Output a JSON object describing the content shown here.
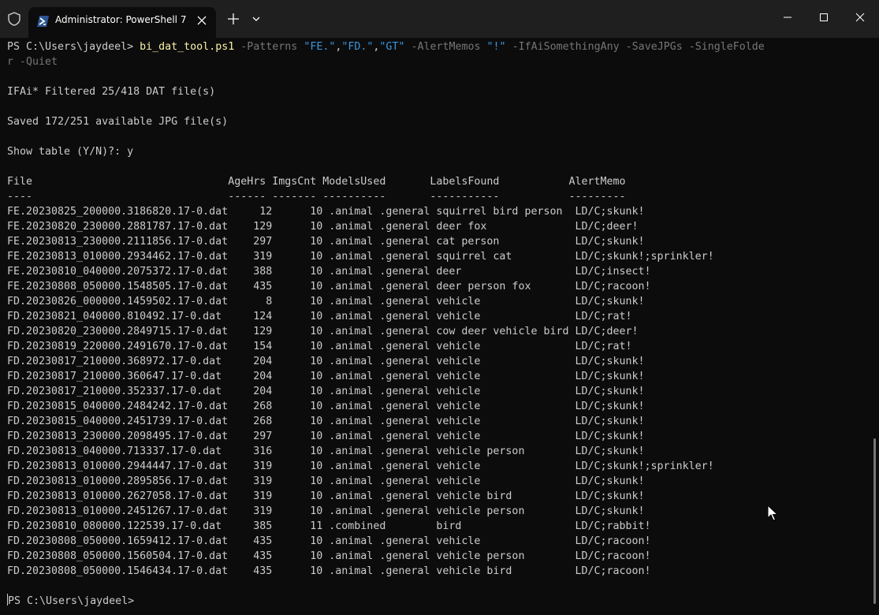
{
  "window": {
    "tab_title": "Administrator: PowerShell 7",
    "icons": [
      "shield-icon",
      "powershell-icon",
      "close-icon",
      "plus-icon",
      "chevron-down-icon",
      "minimize-icon",
      "maximize-icon",
      "close-window-icon"
    ]
  },
  "terminal": {
    "prompt": "PS C:\\Users\\jaydeel> ",
    "command": {
      "script": "bi_dat_tool.ps1",
      "p_patterns": "-Patterns",
      "v_fe": "\"FE.\"",
      "v_fd": "\"FD.\"",
      "v_gt": "\"GT\"",
      "comma": ",",
      "p_alert": "-AlertMemos",
      "v_bang": "\"!\"",
      "p_rest": "-IfAiSomethingAny -SaveJPGs -SingleFolde",
      "p_wrap": "r -Quiet"
    },
    "out_filtered": "IFAi* Filtered 25/418 DAT file(s)",
    "out_saved": "Saved 172/251 available JPG file(s)",
    "out_show": "Show table (Y/N)?: y",
    "table": {
      "header": "File                               AgeHrs ImgsCnt ModelsUsed       LabelsFound           AlertMemo",
      "separator": "----                               ------ ------- ----------       -----------           ---------",
      "rows": [
        "FE.20230825_200000.3186820.17-0.dat     12      10 .animal .general squirrel bird person  LD/C;skunk!",
        "FE.20230820_230000.2881787.17-0.dat    129      10 .animal .general deer fox              LD/C;deer!",
        "FE.20230813_230000.2111856.17-0.dat    297      10 .animal .general cat person            LD/C;skunk!",
        "FE.20230813_010000.2934462.17-0.dat    319      10 .animal .general squirrel cat          LD/C;skunk!;sprinkler!",
        "FE.20230810_040000.2075372.17-0.dat    388      10 .animal .general deer                  LD/C;insect!",
        "FE.20230808_050000.1548505.17-0.dat    435      10 .animal .general deer person fox       LD/C;racoon!",
        "FD.20230826_000000.1459502.17-0.dat      8      10 .animal .general vehicle               LD/C;skunk!",
        "FD.20230821_040000.810492.17-0.dat     124      10 .animal .general vehicle               LD/C;rat!",
        "FD.20230820_230000.2849715.17-0.dat    129      10 .animal .general cow deer vehicle bird LD/C;deer!",
        "FD.20230819_220000.2491670.17-0.dat    154      10 .animal .general vehicle               LD/C;rat!",
        "FD.20230817_210000.368972.17-0.dat     204      10 .animal .general vehicle               LD/C;skunk!",
        "FD.20230817_210000.360647.17-0.dat     204      10 .animal .general vehicle               LD/C;skunk!",
        "FD.20230817_210000.352337.17-0.dat     204      10 .animal .general vehicle               LD/C;skunk!",
        "FD.20230815_040000.2484242.17-0.dat    268      10 .animal .general vehicle               LD/C;skunk!",
        "FD.20230815_040000.2451739.17-0.dat    268      10 .animal .general vehicle               LD/C;skunk!",
        "FD.20230813_230000.2098495.17-0.dat    297      10 .animal .general vehicle               LD/C;skunk!",
        "FD.20230813_040000.713337.17-0.dat     316      10 .animal .general vehicle person        LD/C;skunk!",
        "FD.20230813_010000.2944447.17-0.dat    319      10 .animal .general vehicle               LD/C;skunk!;sprinkler!",
        "FD.20230813_010000.2895856.17-0.dat    319      10 .animal .general vehicle               LD/C;skunk!",
        "FD.20230813_010000.2627058.17-0.dat    319      10 .animal .general vehicle bird          LD/C;skunk!",
        "FD.20230813_010000.2451267.17-0.dat    319      10 .animal .general vehicle person        LD/C;skunk!",
        "FD.20230810_080000.122539.17-0.dat     385      11 .combined        bird                  LD/C;rabbit!",
        "FD.20230808_050000.1659412.17-0.dat    435      10 .animal .general vehicle               LD/C;racoon!",
        "FD.20230808_050000.1560504.17-0.dat    435      10 .animal .general vehicle person        LD/C;racoon!",
        "FD.20230808_050000.1546434.17-0.dat    435      10 .animal .general vehicle bird          LD/C;racoon!"
      ]
    },
    "final_prompt": "PS C:\\Users\\jaydeel>"
  },
  "colors": {
    "background": "#0c0c0c",
    "titlebar": "#1f1f1f",
    "foreground": "#cccccc",
    "command": "#f9f1a5",
    "parameter": "#767676",
    "string": "#3a96dd"
  }
}
